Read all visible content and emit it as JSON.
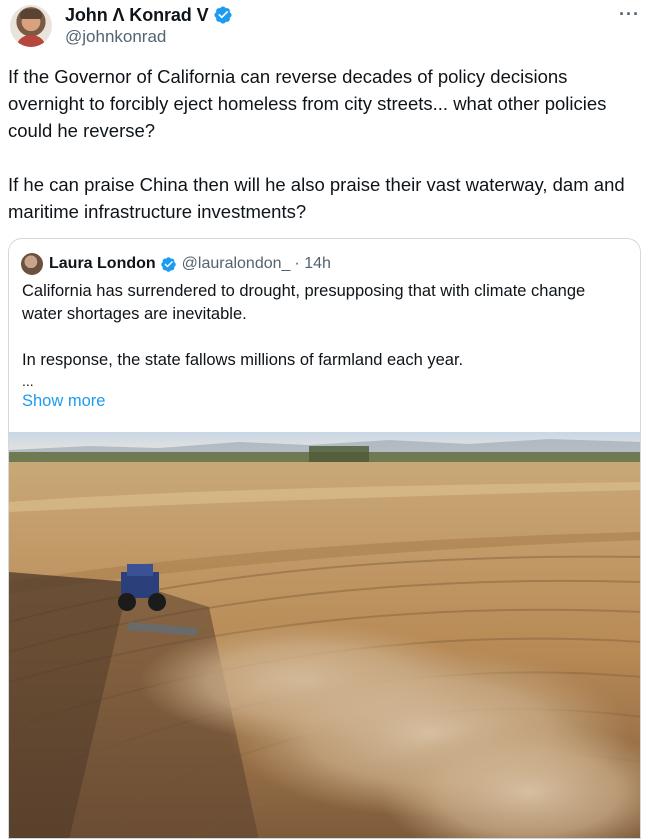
{
  "tweet": {
    "author_name": "John Λ Konrad V",
    "author_handle": "@johnkonrad",
    "more_label": "···",
    "paragraphs": [
      "If the Governor of California can reverse decades of policy decisions overnight to forcibly eject homeless from city streets... what other policies could he reverse?",
      "If he can praise China then will he also praise their vast waterway, dam and maritime infrastructure investments?"
    ]
  },
  "quoted": {
    "author_name": "Laura London",
    "author_handle": "@lauralondon_",
    "time": "· 14h",
    "paragraphs": [
      "California has surrendered to drought, presupposing that with climate change water shortages are inevitable.",
      "In response, the state fallows millions of  farmland each year."
    ],
    "ellipsis": "...",
    "show_more": "Show more"
  },
  "colors": {
    "verified": "#1d9bf0",
    "link": "#1d9bf0",
    "secondary_text": "#536471",
    "border": "#cfd9de"
  },
  "icons": {
    "verified": "verified-badge-icon",
    "more": "more-options-icon"
  }
}
